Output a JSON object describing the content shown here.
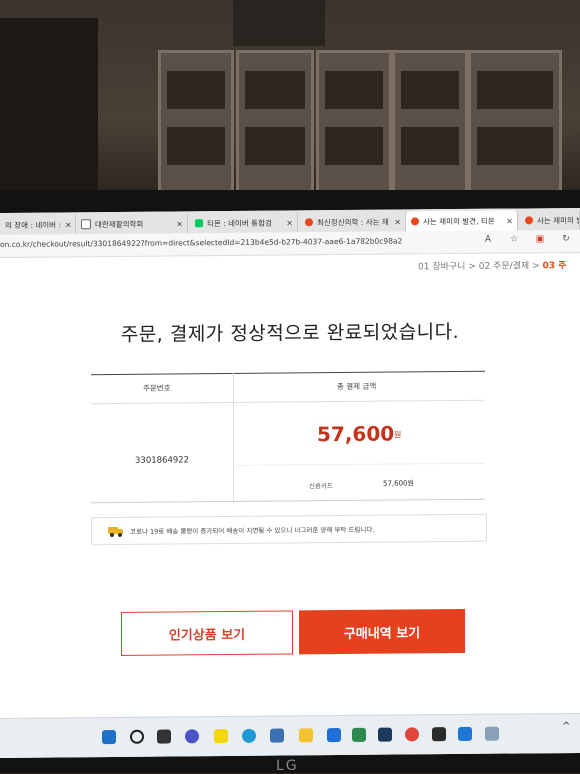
{
  "browser": {
    "tabs": [
      {
        "label": "의 장애 : 네이버 :",
        "icon": "naver-icon",
        "active": false
      },
      {
        "label": "대한재활의학회",
        "icon": "page-icon",
        "active": false
      },
      {
        "label": "티몬 : 네이버 통합검",
        "icon": "naver-icon",
        "active": false
      },
      {
        "label": "최신정신의학 : 사는 재",
        "icon": "red-circle-icon",
        "active": false
      },
      {
        "label": "사는 재미의 발견, 티몬",
        "icon": "red-circle-icon",
        "active": true
      },
      {
        "label": "사는 재미의 발견, 티",
        "icon": "red-circle-icon",
        "active": false
      }
    ],
    "tab_close": "×",
    "url": "on.co.kr/checkout/result/3301864922?from=direct&selectedId=213b4e5d-b27b-4037-aae6-1a782b0c98a2",
    "toolbar_icons": [
      "read-aloud-icon",
      "favorite-icon",
      "extension-icon",
      "refresh-icon"
    ],
    "toolbar_glyphs": [
      "A",
      "☆",
      "▣",
      "↻"
    ]
  },
  "steps": {
    "step1": "01 장바구니",
    "sep": ">",
    "step2": "02 주문/결제",
    "step3": "03 주"
  },
  "page": {
    "headline": "주문, 결제가 정상적으로 완료되었습니다.",
    "order_table": {
      "col_order_no": "주문번호",
      "col_total": "총 결제 금액",
      "order_number": "3301864922",
      "amount": "57,600",
      "amount_unit": "원",
      "payment_method": "신용카드",
      "payment_amount": "57,600원"
    },
    "notice": "코로나 19로 배송 물량이 증가되어 배송이 지연될 수 있으니 너그러운 양해 부탁 드립니다.",
    "buttons": {
      "popular": "인기상품 보기",
      "history": "구매내역 보기"
    }
  },
  "colors": {
    "accent": "#e6411f",
    "price": "#c7321b",
    "truck": "#e7b324"
  },
  "monitor_brand": "LG"
}
